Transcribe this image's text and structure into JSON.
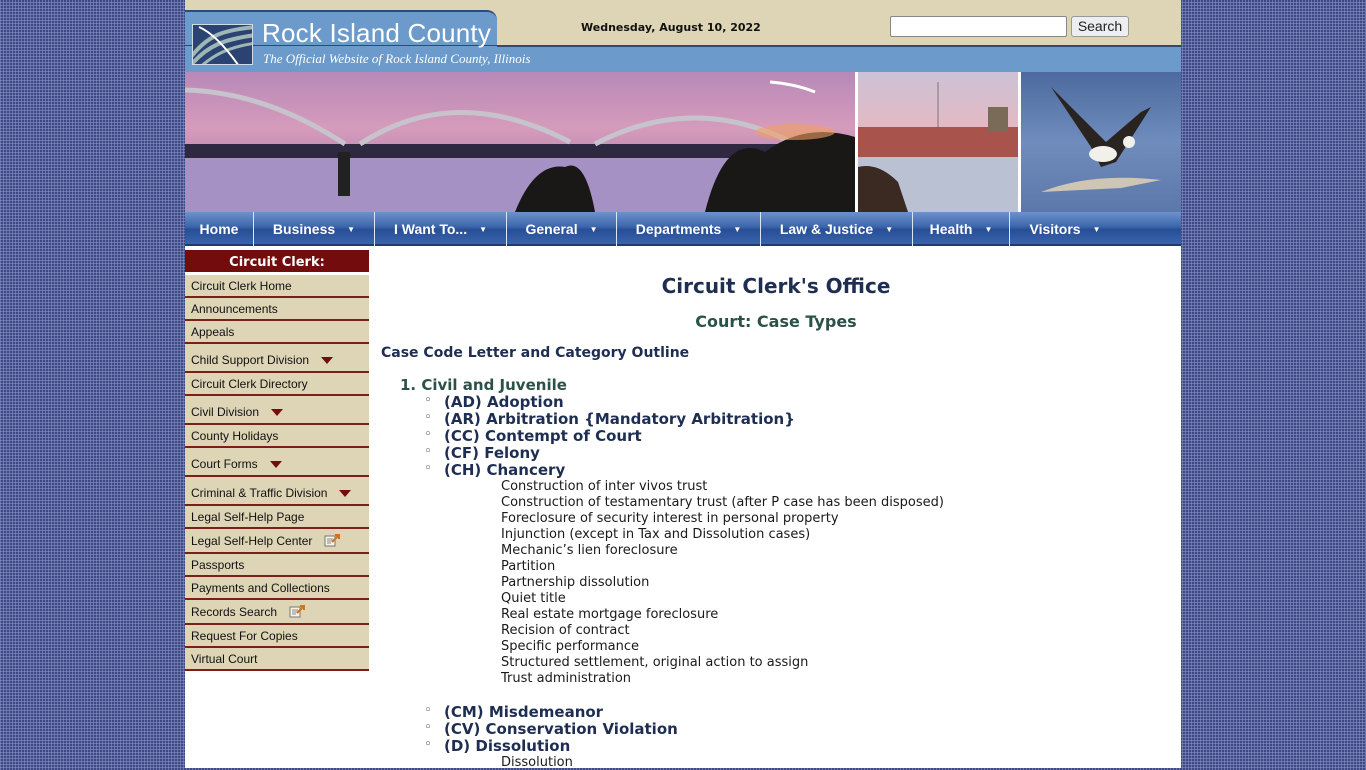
{
  "header": {
    "site_title": "Rock Island County",
    "site_subtitle": "The Official Website of Rock Island County, Illinois",
    "date": "Wednesday, August 10, 2022",
    "search_placeholder": "",
    "search_value": "",
    "search_button": "Search",
    "logo_icon": "river-waves-logo-icon"
  },
  "banner": {
    "images": [
      "bridge-sunset-photo",
      "lock-and-dam-photo",
      "bald-eagle-photo"
    ]
  },
  "nav": {
    "items": [
      {
        "label": "Home",
        "has_dropdown": false
      },
      {
        "label": "Business",
        "has_dropdown": true
      },
      {
        "label": "I Want To...",
        "has_dropdown": true
      },
      {
        "label": "General",
        "has_dropdown": true
      },
      {
        "label": "Departments",
        "has_dropdown": true
      },
      {
        "label": "Law & Justice",
        "has_dropdown": true
      },
      {
        "label": "Health",
        "has_dropdown": true
      },
      {
        "label": "Visitors",
        "has_dropdown": true
      }
    ]
  },
  "sidebar": {
    "heading": "Circuit Clerk:",
    "items": [
      {
        "label": "Circuit Clerk Home"
      },
      {
        "label": "Announcements"
      },
      {
        "label": "Appeals"
      },
      {
        "label": "Child Support Division",
        "icon": "dropdown-triangle-icon"
      },
      {
        "label": "Circuit Clerk Directory"
      },
      {
        "label": "Civil Division",
        "icon": "dropdown-triangle-icon"
      },
      {
        "label": "County Holidays"
      },
      {
        "label": "Court Forms",
        "icon": "dropdown-triangle-icon"
      },
      {
        "label": "Criminal & Traffic Division",
        "icon": "dropdown-triangle-icon"
      },
      {
        "label": "Legal Self-Help Page"
      },
      {
        "label": "Legal Self-Help Center",
        "icon": "external-link-icon"
      },
      {
        "label": "Passports"
      },
      {
        "label": "Payments and Collections"
      },
      {
        "label": "Records Search",
        "icon": "external-link-icon"
      },
      {
        "label": "Request For Copies"
      },
      {
        "label": "Virtual Court"
      }
    ]
  },
  "content": {
    "title": "Circuit Clerk's Office",
    "subtitle": "Court:  Case Types",
    "outline_title": "Case Code Letter and Category Outline",
    "section_title": "1. Civil and Juvenile",
    "categories": [
      {
        "label": "(AD) Adoption"
      },
      {
        "label": "(AR) Arbitration {Mandatory Arbitration}"
      },
      {
        "label": "(CC) Contempt of Court"
      },
      {
        "label": "(CF) Felony"
      },
      {
        "label": "(CH) Chancery",
        "subitems": [
          "Construction of inter vivos trust",
          "Construction of testamentary trust (after P case has been disposed)",
          "Foreclosure of security interest in personal property",
          "Injunction (except in Tax and Dissolution cases)",
          "Mechanic’s lien foreclosure",
          "Partition",
          "Partnership dissolution",
          "Quiet title",
          "Real estate mortgage foreclosure",
          "Recision of contract",
          "Specific performance",
          "Structured settlement, original action to assign",
          "Trust administration"
        ]
      },
      {
        "label": "(CM) Misdemeanor"
      },
      {
        "label": "(CV) Conservation Violation"
      },
      {
        "label": "(D) Dissolution",
        "subitems": [
          "Dissolution"
        ]
      }
    ]
  }
}
